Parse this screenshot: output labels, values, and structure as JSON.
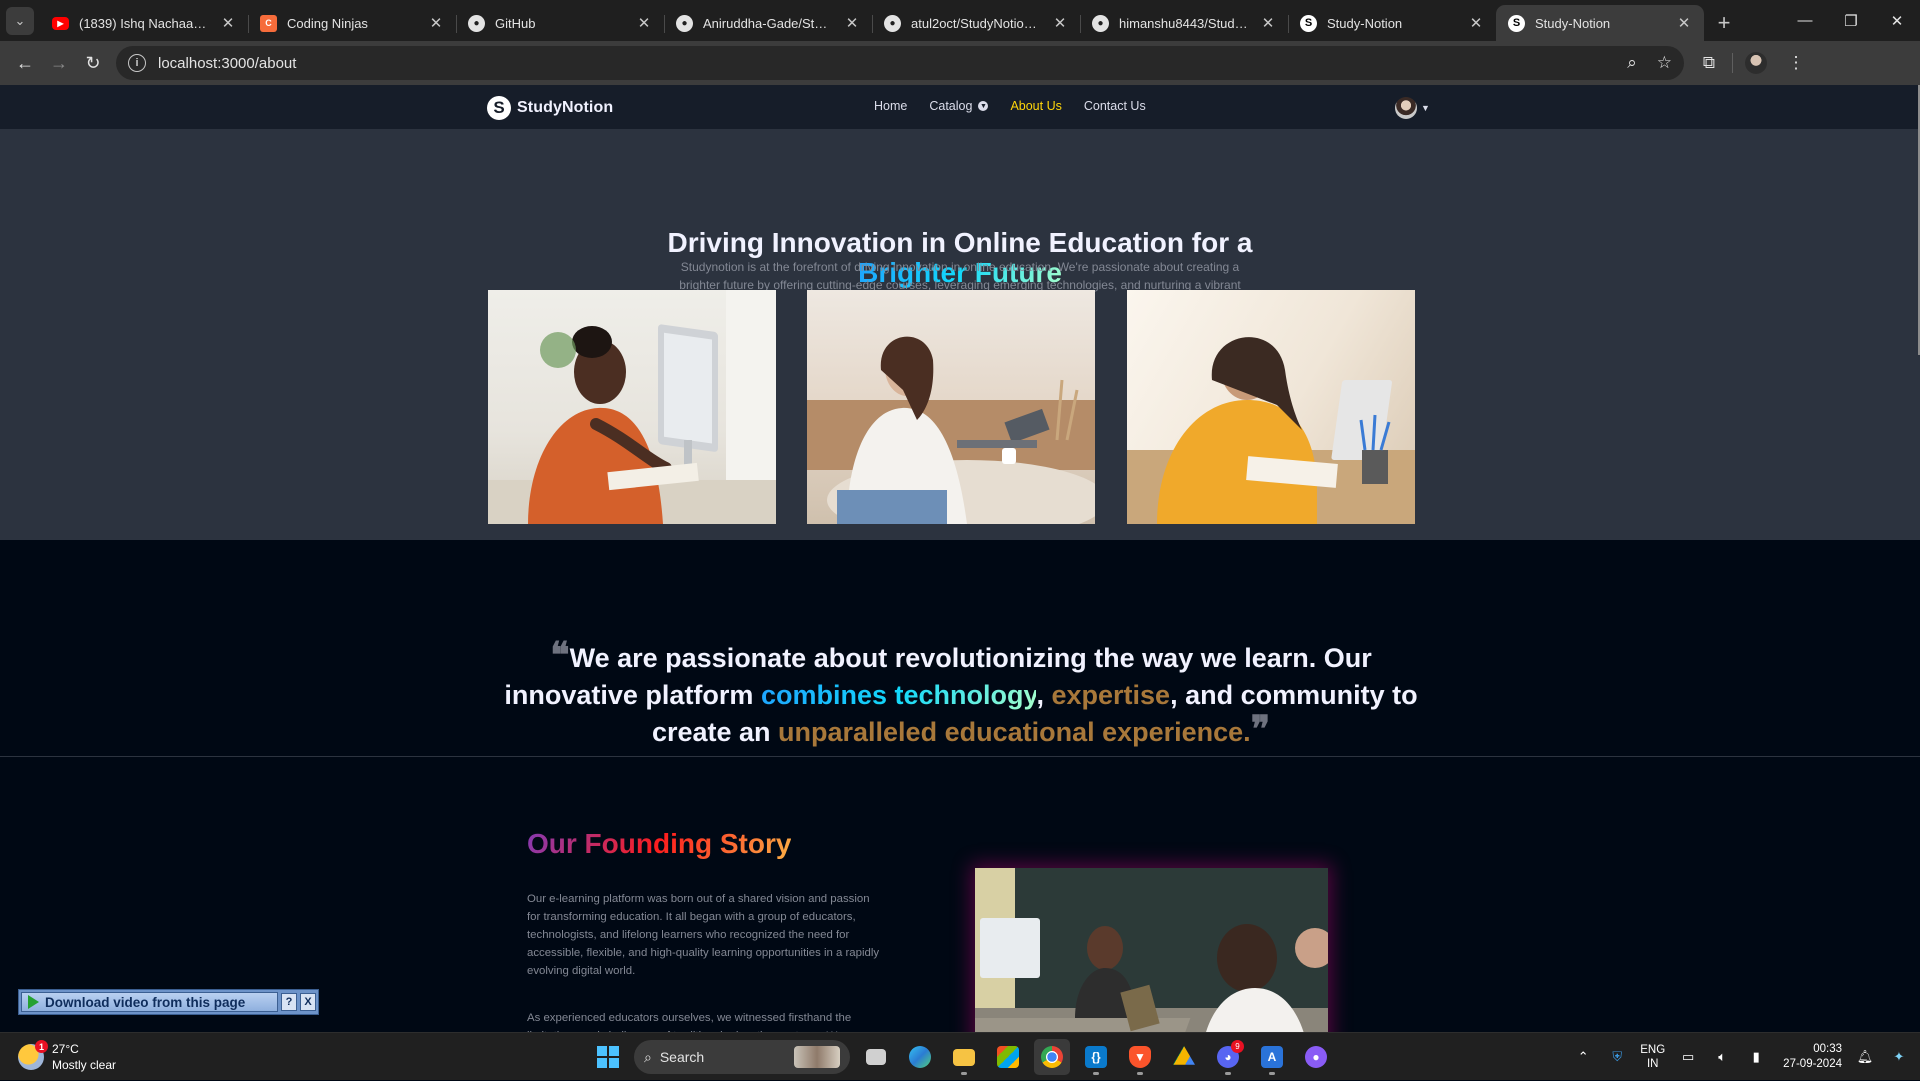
{
  "browser": {
    "tabs": [
      {
        "title": "(1839) Ishq Nachaawe - K",
        "icon": "youtube-icon",
        "active": false
      },
      {
        "title": "Coding Ninjas",
        "icon": "coding-ninjas-icon",
        "active": false
      },
      {
        "title": "GitHub",
        "icon": "github-icon",
        "active": false
      },
      {
        "title": "Aniruddha-Gade/Study-N",
        "icon": "github-icon",
        "active": false
      },
      {
        "title": "atul2oct/StudyNotion-Ed",
        "icon": "github-icon",
        "active": false
      },
      {
        "title": "himanshu8443/Study-No",
        "icon": "github-icon",
        "active": false
      },
      {
        "title": "Study-Notion",
        "icon": "studynotion-icon",
        "active": false
      },
      {
        "title": "Study-Notion",
        "icon": "studynotion-icon",
        "active": true
      }
    ],
    "url": "localhost:3000/about"
  },
  "site": {
    "logo_mark": "S",
    "logo_text": "StudyNotion",
    "nav": {
      "home": "Home",
      "catalog": "Catalog",
      "about": "About Us",
      "contact": "Contact Us"
    }
  },
  "hero": {
    "title_line1": "Driving Innovation in Online Education for a",
    "title_highlight": "Brighter Future",
    "description": "Studynotion is at the forefront of driving innovation in online education. We're passionate about creating a brighter future by offering cutting-edge courses, leveraging emerging technologies, and nurturing a vibrant"
  },
  "quote": {
    "part1": "We are passionate about revolutionizing the way we learn. Our innovative platform ",
    "highlight1": "combines technology",
    "sep1": ", ",
    "highlight2": "expertise",
    "part2": ", and community to create an ",
    "highlight3": "unparalleled educational experience."
  },
  "founding_story": {
    "title": "Our Founding Story",
    "paragraph1": "Our e-learning platform was born out of a shared vision and passion for transforming education. It all began with a group of educators, technologists, and lifelong learners who recognized the need for accessible, flexible, and high-quality learning opportunities in a rapidly evolving digital world.",
    "paragraph2": "As experienced educators ourselves, we witnessed firsthand the limitations and challenges of traditional education systems. We believed that education should not be confined to the walls of a classroom or restricted by geographical boundaries. We envisioned a platform that could bridge these gaps and empower individuals from all walks of life to unlock their full potential."
  },
  "download_bar": {
    "label": "Download video from this page",
    "help": "?",
    "close": "X"
  },
  "taskbar": {
    "weather_temp": "27°C",
    "weather_desc": "Mostly clear",
    "weather_badge": "1",
    "search_placeholder": "Search",
    "discord_badge": "9",
    "lang_line1": "ENG",
    "lang_line2": "IN",
    "time": "00:33",
    "date": "27-09-2024"
  },
  "colors": {
    "page_bg": "#000814",
    "hero_bg": "#2c333f",
    "nav_bg": "#161d29",
    "active_nav": "#ffd60a",
    "blue_gradient": "#12d8fa",
    "story_gradient": "#fd1d1d"
  }
}
